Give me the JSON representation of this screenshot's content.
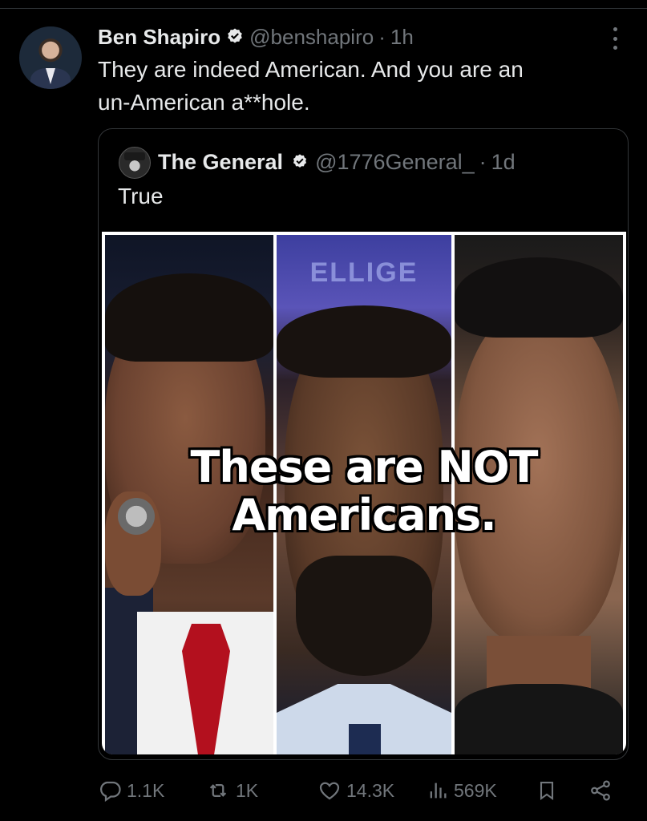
{
  "tweet": {
    "author_name": "Ben Shapiro",
    "author_handle": "@benshapiro",
    "separator": "·",
    "time": "1h",
    "text": "They are indeed American. And you are an\nun-American a**hole."
  },
  "quoted_tweet": {
    "author_name": "The General",
    "author_handle": "@1776General_",
    "separator": "·",
    "time": "1d",
    "text": "True",
    "media": {
      "overlay_text": "These are NOT\nAmericans.",
      "banner_fragment": "ELLIGE"
    }
  },
  "actions": {
    "reply_count": "1.1K",
    "retweet_count": "1K",
    "like_count": "14.3K",
    "view_count": "569K"
  },
  "icons": {
    "verified": "verified-badge-icon",
    "more": "more-options-icon",
    "reply": "reply-icon",
    "retweet": "retweet-icon",
    "like": "heart-icon",
    "views": "views-icon",
    "bookmark": "bookmark-icon",
    "share": "share-icon"
  },
  "colors": {
    "background": "#000000",
    "text": "#e7e9ea",
    "muted": "#71767b",
    "verified": "#1d9bf0"
  }
}
